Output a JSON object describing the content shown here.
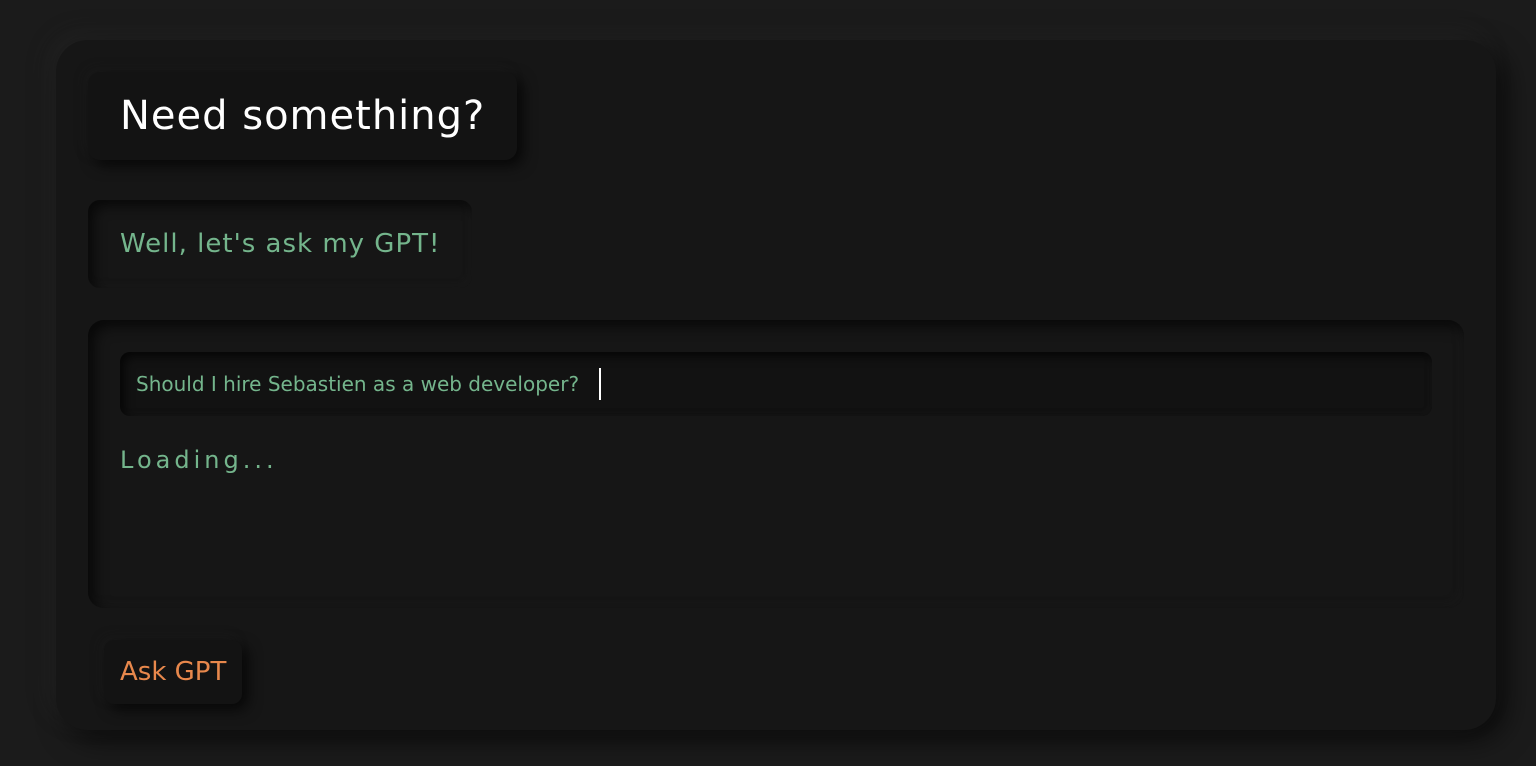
{
  "header": {
    "title": "Need something?"
  },
  "subtitle": {
    "text": "Well, let's ask my GPT!"
  },
  "chat": {
    "query_value": "Should I hire Sebastien as a web developer?",
    "status_text": "Loading..."
  },
  "actions": {
    "ask_label": "Ask GPT"
  },
  "colors": {
    "background": "#1b1b1b",
    "card": "#161616",
    "accent_green": "#74b58c",
    "accent_orange": "#e8884c",
    "title_text": "#ffffff"
  }
}
